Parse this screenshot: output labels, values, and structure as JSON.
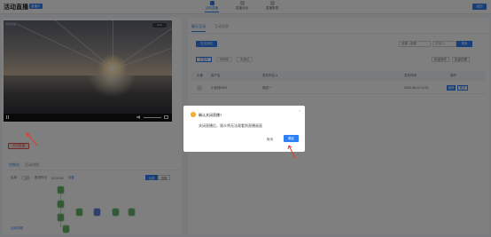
{
  "header": {
    "title": "活动直播",
    "badge": "直播中",
    "tabs": [
      {
        "label": "活动直播"
      },
      {
        "label": "直播活动"
      },
      {
        "label": "直播数据"
      }
    ],
    "right_button": "返回"
  },
  "video": {
    "label": "活动直播",
    "pill": "1.0x"
  },
  "left": {
    "close_live": "关闭直播",
    "subtabs": [
      "控制台",
      "活动流程"
    ],
    "options": {
      "switch_label": "启用",
      "label2": "推流时长",
      "label3": "00:00:00",
      "link": "设置"
    },
    "seg": [
      "全部",
      "流程"
    ],
    "footer": "活动流程"
  },
  "right": {
    "tabs": [
      "聊天互动",
      "互动消息"
    ],
    "action": "发送消息",
    "select": "全部 / 全部",
    "input_placeholder": "请输入",
    "search": "搜索",
    "filters": [
      "已发布",
      "待审核",
      "未通过"
    ],
    "small_buttons": [
      "批量操作",
      "批量设置"
    ],
    "table": {
      "headers": [
        "头像",
        "用户名",
        "发布内容 ●",
        "发布时间",
        "操作"
      ],
      "rows": [
        {
          "name": "小铃铛0001",
          "content": "测试一",
          "time": "2024-06-12 14:21",
          "edit": "编辑",
          "more": "更多"
        }
      ]
    }
  },
  "dialog": {
    "icon": "!",
    "title": "确认关闭直播?",
    "message": "关闭直播后，观众将无法观看到直播画面",
    "cancel": "取消",
    "ok": "确定",
    "close": "×"
  },
  "colors": {
    "primary": "#2f7ff7",
    "danger": "#e0534a",
    "warning": "#f5a623"
  }
}
